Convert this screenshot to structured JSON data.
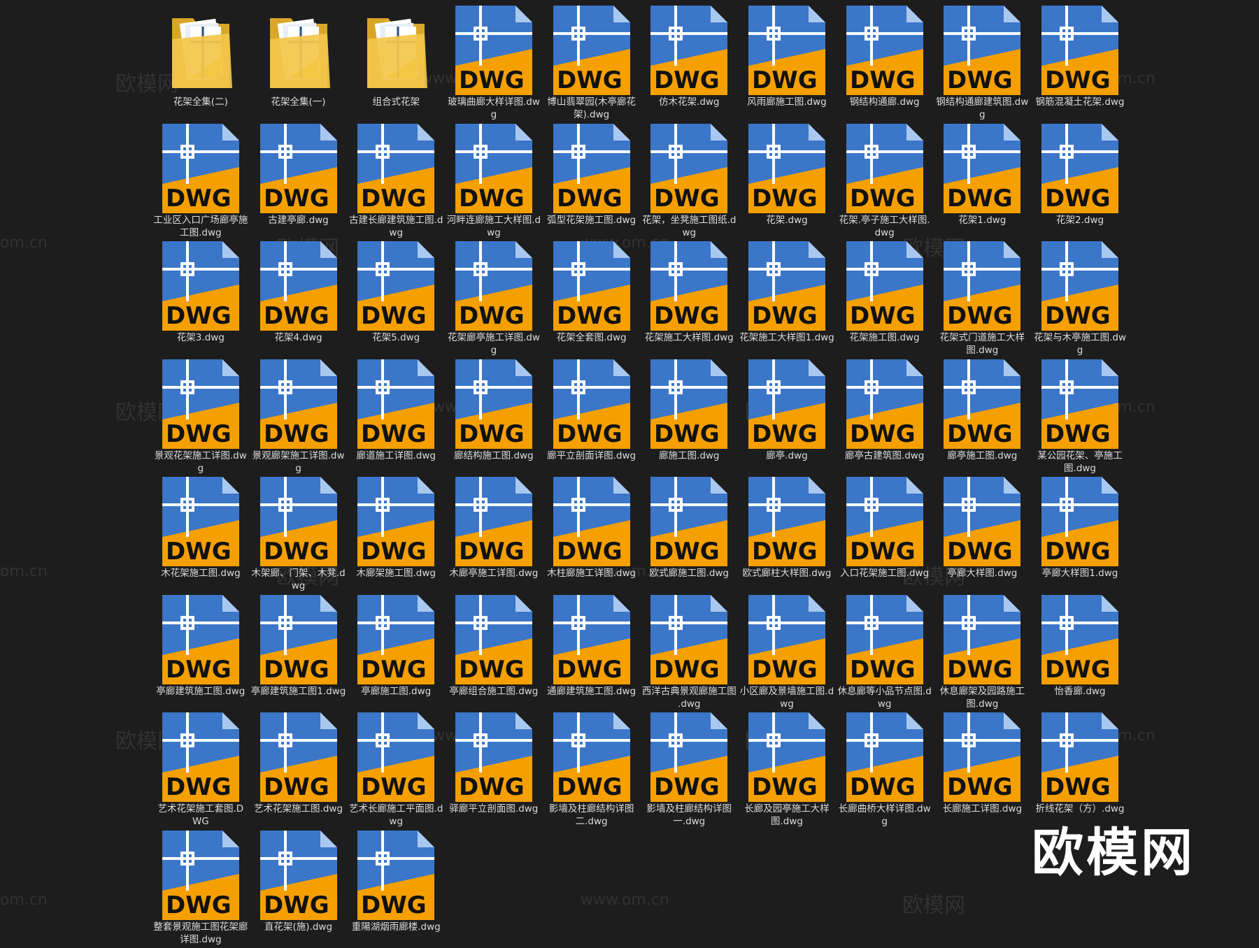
{
  "icons": {
    "folder": "folder-icon",
    "file": "dwg-file-icon"
  },
  "colors": {
    "background": "#1d1d1d",
    "dwg_blue": "#3b76c8",
    "dwg_orange": "#f5a000",
    "folder_yellow": "#f3c74a"
  },
  "files": [
    {
      "name": "花架全集(二)",
      "type": "folder"
    },
    {
      "name": "花架全集(一)",
      "type": "folder"
    },
    {
      "name": "组合式花架",
      "type": "folder"
    },
    {
      "name": "玻璃曲廊大样详图.dwg",
      "type": "dwg"
    },
    {
      "name": "博山翡翠园(木亭廊花架).dwg",
      "type": "dwg"
    },
    {
      "name": "仿木花架.dwg",
      "type": "dwg"
    },
    {
      "name": "风雨廊施工图.dwg",
      "type": "dwg"
    },
    {
      "name": "钢结构通廊.dwg",
      "type": "dwg"
    },
    {
      "name": "钢结构通廊建筑图.dwg",
      "type": "dwg"
    },
    {
      "name": "钢筋混凝土花架.dwg",
      "type": "dwg"
    },
    {
      "name": "工业区入口广场廊亭施工图.dwg",
      "type": "dwg"
    },
    {
      "name": "古建亭廊.dwg",
      "type": "dwg"
    },
    {
      "name": "古建长廊建筑施工图.dwg",
      "type": "dwg"
    },
    {
      "name": "河畔连廊施工大样图.dwg",
      "type": "dwg"
    },
    {
      "name": "弧型花架施工图.dwg",
      "type": "dwg"
    },
    {
      "name": "花架，坐凳施工图纸.dwg",
      "type": "dwg"
    },
    {
      "name": "花架.dwg",
      "type": "dwg"
    },
    {
      "name": "花架.亭子施工大样图.dwg",
      "type": "dwg"
    },
    {
      "name": "花架1.dwg",
      "type": "dwg"
    },
    {
      "name": "花架2.dwg",
      "type": "dwg"
    },
    {
      "name": "花架3.dwg",
      "type": "dwg"
    },
    {
      "name": "花架4.dwg",
      "type": "dwg"
    },
    {
      "name": "花架5.dwg",
      "type": "dwg"
    },
    {
      "name": "花架廊亭施工详图.dwg",
      "type": "dwg"
    },
    {
      "name": "花架全套图.dwg",
      "type": "dwg"
    },
    {
      "name": "花架施工大样图.dwg",
      "type": "dwg"
    },
    {
      "name": "花架施工大样图1.dwg",
      "type": "dwg"
    },
    {
      "name": "花架施工图.dwg",
      "type": "dwg"
    },
    {
      "name": "花架式门道施工大样图.dwg",
      "type": "dwg"
    },
    {
      "name": "花架与木亭施工图.dwg",
      "type": "dwg"
    },
    {
      "name": "景观花架施工详图.dwg",
      "type": "dwg"
    },
    {
      "name": "景观廊架施工详图.dwg",
      "type": "dwg"
    },
    {
      "name": "廊道施工详图.dwg",
      "type": "dwg"
    },
    {
      "name": "廊结构施工图.dwg",
      "type": "dwg"
    },
    {
      "name": "廊平立剖面详图.dwg",
      "type": "dwg"
    },
    {
      "name": "廊施工图.dwg",
      "type": "dwg"
    },
    {
      "name": "廊亭.dwg",
      "type": "dwg"
    },
    {
      "name": "廊亭古建筑图.dwg",
      "type": "dwg"
    },
    {
      "name": "廊亭施工图.dwg",
      "type": "dwg"
    },
    {
      "name": "某公园花架、亭施工图.dwg",
      "type": "dwg"
    },
    {
      "name": "木花架施工图.dwg",
      "type": "dwg"
    },
    {
      "name": "木架廊、门架、木凳.dwg",
      "type": "dwg"
    },
    {
      "name": "木廊架施工图.dwg",
      "type": "dwg"
    },
    {
      "name": "木廊亭施工详图.dwg",
      "type": "dwg"
    },
    {
      "name": "木柱廊施工详图.dwg",
      "type": "dwg"
    },
    {
      "name": "欧式廊施工图.dwg",
      "type": "dwg"
    },
    {
      "name": "欧式廊柱大样图.dwg",
      "type": "dwg"
    },
    {
      "name": "入口花架施工图.dwg",
      "type": "dwg"
    },
    {
      "name": "亭廊大样图.dwg",
      "type": "dwg"
    },
    {
      "name": "亭廊大样图1.dwg",
      "type": "dwg"
    },
    {
      "name": "亭廊建筑施工图.dwg",
      "type": "dwg"
    },
    {
      "name": "亭廊建筑施工图1.dwg",
      "type": "dwg"
    },
    {
      "name": "亭廊施工图.dwg",
      "type": "dwg"
    },
    {
      "name": "亭廊组合施工图.dwg",
      "type": "dwg"
    },
    {
      "name": "通廊建筑施工图.dwg",
      "type": "dwg"
    },
    {
      "name": "西洋古典景观廊施工图 .dwg",
      "type": "dwg"
    },
    {
      "name": "小区廊及景墙施工图.dwg",
      "type": "dwg"
    },
    {
      "name": "休息廊等小品节点图.dwg",
      "type": "dwg"
    },
    {
      "name": "休息廊架及园路施工图.dwg",
      "type": "dwg"
    },
    {
      "name": "怡香廊.dwg",
      "type": "dwg"
    },
    {
      "name": "艺术花架施工套图.DWG",
      "type": "dwg"
    },
    {
      "name": "艺术花架施工图.dwg",
      "type": "dwg"
    },
    {
      "name": "艺术长廊施工平面图.dwg",
      "type": "dwg"
    },
    {
      "name": "驿廊平立剖面图.dwg",
      "type": "dwg"
    },
    {
      "name": "影墙及柱廊结构详图二.dwg",
      "type": "dwg"
    },
    {
      "name": "影墙及柱廊结构详图一.dwg",
      "type": "dwg"
    },
    {
      "name": "长廊及园亭施工大样图.dwg",
      "type": "dwg"
    },
    {
      "name": "长廊曲桥大样详图.dwg",
      "type": "dwg"
    },
    {
      "name": "长廊施工详图.dwg",
      "type": "dwg"
    },
    {
      "name": "折线花架（方）.dwg",
      "type": "dwg"
    },
    {
      "name": "整套景观施工图花架廊详图.dwg",
      "type": "dwg"
    },
    {
      "name": "直花架(施).dwg",
      "type": "dwg"
    },
    {
      "name": "重陽湖烟雨廊楼.dwg",
      "type": "dwg"
    }
  ],
  "dwg_badge": "DWG",
  "watermark": {
    "text_cn": "欧模网",
    "text_url": "www.om.cn",
    "text_url_left": "om.cn"
  },
  "logo_text": "欧模网"
}
